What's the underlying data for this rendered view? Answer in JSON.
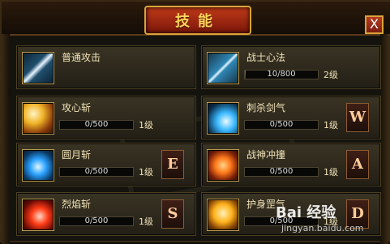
{
  "window": {
    "title": "技能",
    "close": "X"
  },
  "skills": [
    {
      "name": "普通攻击",
      "progress": null,
      "level": null,
      "hotkey": null
    },
    {
      "name": "战士心法",
      "progress": {
        "text": "10/800",
        "fraction": 0.0125
      },
      "level": "2级",
      "hotkey": null
    },
    {
      "name": "攻心斩",
      "progress": {
        "text": "0/500",
        "fraction": 0
      },
      "level": "1级",
      "hotkey": null
    },
    {
      "name": "刺杀剑气",
      "progress": {
        "text": "0/500",
        "fraction": 0
      },
      "level": "1级",
      "hotkey": "W"
    },
    {
      "name": "圆月斩",
      "progress": {
        "text": "0/500",
        "fraction": 0
      },
      "level": "1级",
      "hotkey": "E"
    },
    {
      "name": "战神冲撞",
      "progress": {
        "text": "0/500",
        "fraction": 0
      },
      "level": "1级",
      "hotkey": "A"
    },
    {
      "name": "烈焰斩",
      "progress": {
        "text": "0/500",
        "fraction": 0
      },
      "level": "1级",
      "hotkey": "S"
    },
    {
      "name": "护身罡气",
      "progress": {
        "text": "0/500",
        "fraction": 0
      },
      "level": "1级",
      "hotkey": "D"
    }
  ],
  "watermark": {
    "logo": "Bai 经验",
    "sub": "jingyan.baidu.com"
  },
  "colors": {
    "accent": "#d8a33a",
    "bar": "#1c86ff"
  }
}
